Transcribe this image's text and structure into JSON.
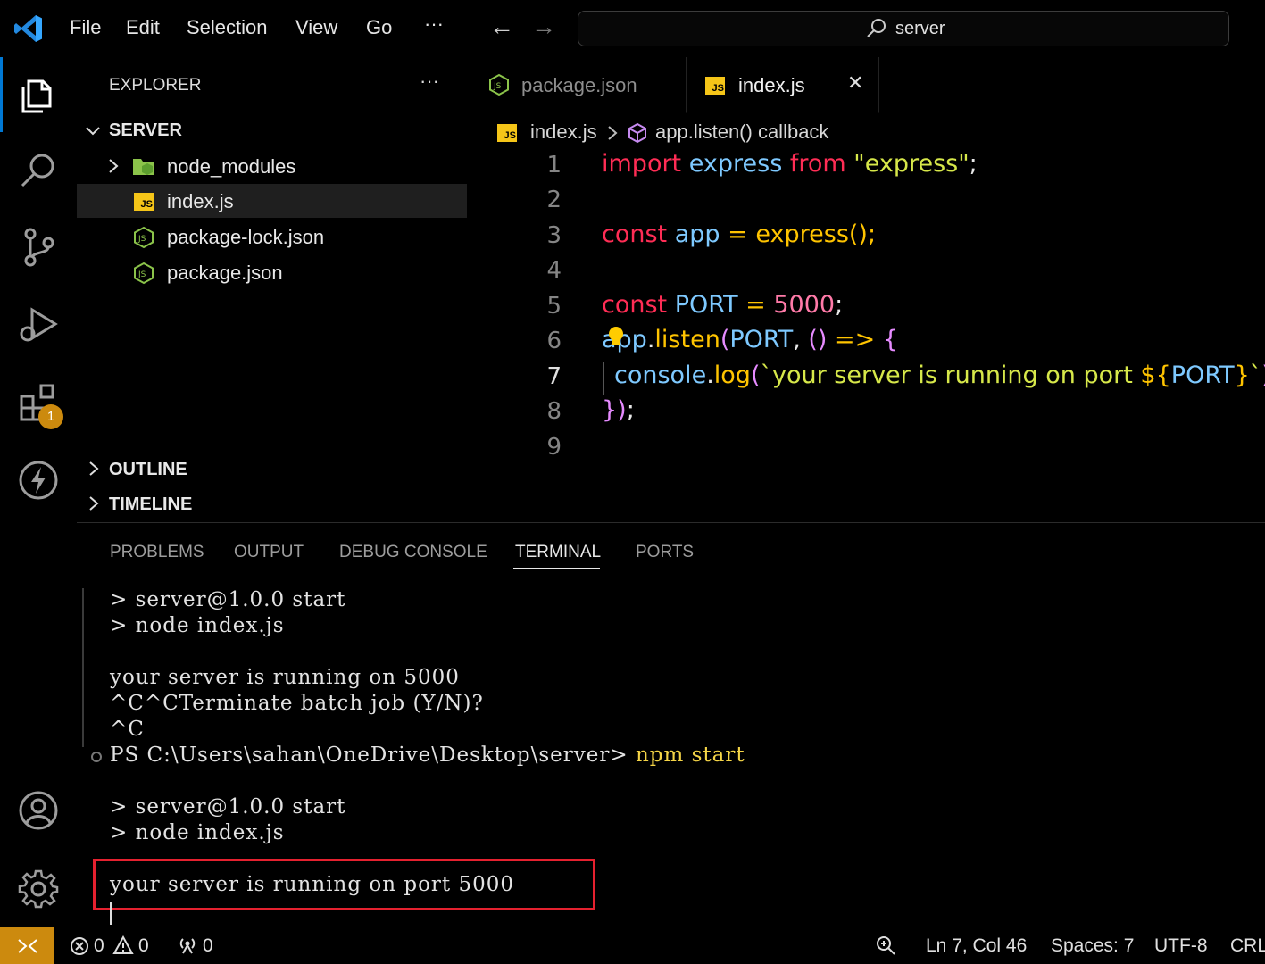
{
  "menu": {
    "items": [
      "File",
      "Edit",
      "Selection",
      "View",
      "Go"
    ],
    "more": "···",
    "back": "←",
    "forward": "→",
    "search_text": "server"
  },
  "activity": {
    "extensions_badge": "1"
  },
  "explorer": {
    "title": "EXPLORER",
    "more": "···",
    "folder": "SERVER",
    "files": [
      {
        "name": "node_modules",
        "icon": "folder-icon"
      },
      {
        "name": "index.js",
        "icon": "js-icon"
      },
      {
        "name": "package-lock.json",
        "icon": "nodejs-icon"
      },
      {
        "name": "package.json",
        "icon": "nodejs-icon"
      }
    ],
    "outline": "OUTLINE",
    "timeline": "TIMELINE"
  },
  "editor": {
    "tabs": [
      {
        "label": "package.json",
        "icon": "nodejs-icon"
      },
      {
        "label": "index.js",
        "icon": "js-icon",
        "close": "✕"
      }
    ],
    "breadcrumb": {
      "file": "index.js",
      "symbol": "app.listen() callback"
    },
    "line_numbers": [
      "1",
      "2",
      "3",
      "4",
      "5",
      "6",
      "7",
      "8",
      "9"
    ]
  },
  "panel": {
    "tabs": [
      "PROBLEMS",
      "OUTPUT",
      "DEBUG CONSOLE",
      "TERMINAL",
      "PORTS"
    ],
    "terminal_lines": [
      "> server@1.0.0 start",
      "> node index.js",
      "",
      "your server is running on 5000",
      "^C^CTerminate batch job (Y/N)?",
      "^C",
      "PS C:\\Users\\sahan\\OneDrive\\Desktop\\server> ",
      "",
      "> server@1.0.0 start",
      "> node index.js",
      "",
      "your server is running on port 5000"
    ],
    "prompt_command": "npm start"
  },
  "status": {
    "errors": "0",
    "warnings": "0",
    "ports": "0",
    "position": "Ln 7, Col 46",
    "spaces": "Spaces: 7",
    "encoding": "UTF-8",
    "eol": "CRL"
  },
  "colors": {
    "accent": "#0078d4",
    "highlight_box": "#e5212f",
    "remote": "#cc8a0e"
  }
}
